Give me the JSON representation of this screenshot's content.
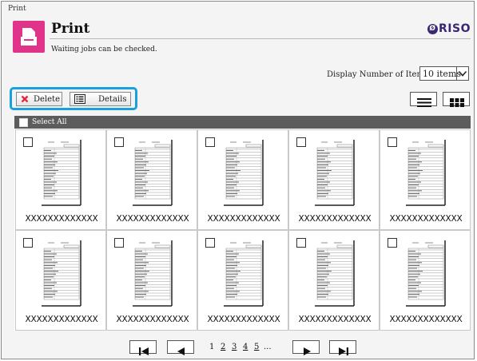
{
  "breadcrumb": "Print",
  "header": {
    "title": "Print",
    "subtitle": "Waiting jobs can be checked.",
    "brand": "RISO",
    "brand_mark": "Ø",
    "accent_color": "#e0338a"
  },
  "display": {
    "label": "Display Number of Items:",
    "value": "10 items"
  },
  "toolbar": {
    "delete_label": "Delete",
    "details_label": "Details",
    "highlight_color": "#1aa0dc"
  },
  "select_all": "Select All",
  "jobs": [
    {
      "name": "XXXXXXXXXXXXX"
    },
    {
      "name": "XXXXXXXXXXXXX"
    },
    {
      "name": "XXXXXXXXXXXXX"
    },
    {
      "name": "XXXXXXXXXXXXX"
    },
    {
      "name": "XXXXXXXXXXXXX"
    },
    {
      "name": "XXXXXXXXXXXXX"
    },
    {
      "name": "XXXXXXXXXXXXX"
    },
    {
      "name": "XXXXXXXXXXXXX"
    },
    {
      "name": "XXXXXXXXXXXXX"
    },
    {
      "name": "XXXXXXXXXXXXX"
    }
  ],
  "pagination": {
    "pages": [
      "1",
      "2",
      "3",
      "4",
      "5"
    ],
    "current": "1",
    "ellipsis": "..."
  }
}
